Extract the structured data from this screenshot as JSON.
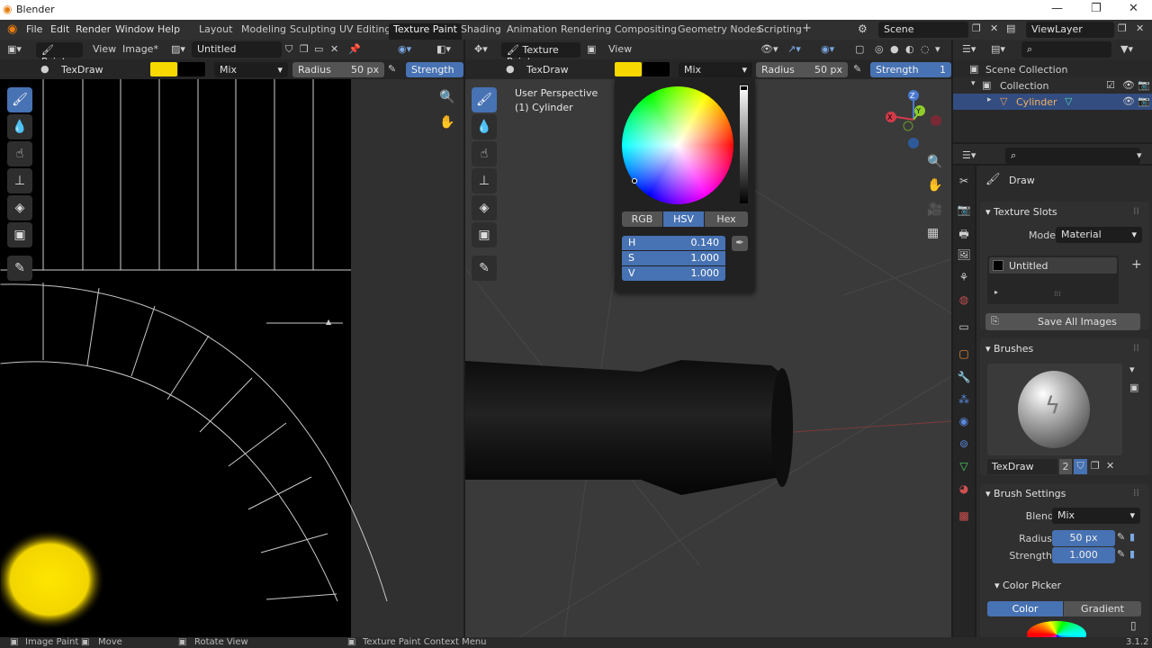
{
  "titlebar": {
    "app_name": "Blender",
    "minimize": "—",
    "restore": "❐",
    "close": "✕"
  },
  "menu": [
    "File",
    "Edit",
    "Render",
    "Window",
    "Help"
  ],
  "workspaces": [
    "Layout",
    "Modeling",
    "Sculpting",
    "UV Editing",
    "Texture Paint",
    "Shading",
    "Animation",
    "Rendering",
    "Compositing",
    "Geometry Nodes",
    "Scripting"
  ],
  "workspace_add": "+",
  "scene": "Scene",
  "view_layer": "ViewLayer",
  "image_editor": {
    "mode": "Paint",
    "menu_view": "View",
    "menu_image": "Image*",
    "image_name": "Untitled",
    "brush_name": "TexDraw",
    "blend": "Mix",
    "radius_label": "Radius",
    "radius_value": "50 px",
    "strength_label": "Strength"
  },
  "viewport": {
    "mode": "Texture Paint",
    "menu_view": "View",
    "brush_name": "TexDraw",
    "blend": "Mix",
    "radius_label": "Radius",
    "radius_value": "50 px",
    "strength_label": "Strength",
    "strength_value": "1",
    "perspective": "User Perspective",
    "object": "(1) Cylinder"
  },
  "color_picker": {
    "tabs": [
      "RGB",
      "HSV",
      "Hex"
    ],
    "active_tab": "HSV",
    "h_label": "H",
    "h_value": "0.140",
    "s_label": "S",
    "s_value": "1.000",
    "v_label": "V",
    "v_value": "1.000"
  },
  "outliner": {
    "scene_collection": "Scene Collection",
    "collection": "Collection",
    "object": "Cylinder"
  },
  "properties": {
    "tool": "Draw",
    "texture_slots_title": "Texture Slots",
    "mode_label": "Mode",
    "mode_value": "Material",
    "slot": "Untitled",
    "save_all": "Save All Images",
    "brushes_title": "Brushes",
    "brush_name": "TexDraw",
    "brush_users": "2",
    "brush_settings_title": "Brush Settings",
    "blend_label": "Blend",
    "blend_value": "Mix",
    "radius_label": "Radius",
    "radius_value": "50 px",
    "strength_label": "Strength",
    "strength_value": "1.000",
    "color_picker_title": "Color Picker",
    "color_tab": "Color",
    "gradient_tab": "Gradient"
  },
  "status": {
    "image_paint": "Image Paint",
    "move": "Move",
    "rotate": "Rotate View",
    "context_menu": "Texture Paint Context Menu",
    "version": "3.1.2"
  },
  "colors": {
    "accent": "#4772b3",
    "brush_color": "#f7d800",
    "bg": "#1d1d1d"
  },
  "icons": [
    "blender-logo-icon",
    "brush-icon",
    "eyedropper-icon",
    "hand-icon",
    "zoom-icon",
    "camera-icon",
    "grid-icon",
    "eye-icon",
    "filter-icon",
    "search-icon"
  ]
}
